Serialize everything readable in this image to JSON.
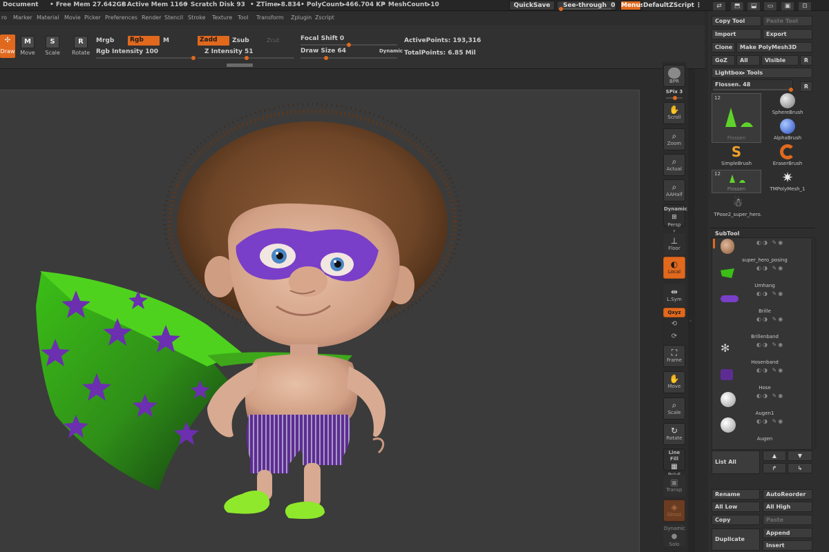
{
  "titlebar": {
    "document": "Document",
    "free_mem": "• Free Mem 27.642GB",
    "active_mem": "• Active Mem 1166",
    "scratch_disk": "• Scratch Disk 93",
    "ztime": "• ZTime▸8.834",
    "polycount": "• PolyCount▸466.704 KP",
    "meshcount": "• MeshCount▸10",
    "quicksave": "QuickSave",
    "see_through": "See-through",
    "see_through_value": "0",
    "menus": "Menus",
    "default_zscript": "DefaultZScript"
  },
  "menubar": [
    "ro",
    "Marker",
    "Material",
    "Movie",
    "Picker",
    "Preferences",
    "Render",
    "Stencil",
    "Stroke",
    "Texture",
    "Tool",
    "Transform",
    "Zplugin",
    "Zscript"
  ],
  "toolbar": {
    "draw": "Draw",
    "move": "Move",
    "scale": "Scale",
    "rotate": "Rotate",
    "mrgb": "Mrgb",
    "rgb": "Rgb",
    "m": "M",
    "rgb_intensity": "Rgb Intensity 100",
    "zadd": "Zadd",
    "zsub": "Zsub",
    "zcut": "Zcut",
    "z_intensity": "Z Intensity 51",
    "focal_shift": "Focal Shift 0",
    "draw_size": "Draw Size 64",
    "dynamic": "Dynamic",
    "active_points": "ActivePoints: 193,316",
    "total_points": "TotalPoints: 6.85 Mil"
  },
  "toolbar_levels": {
    "rgb_intensity": 100,
    "z_intensity": 51,
    "focal_shift": 0,
    "draw_size": 64
  },
  "shelf": {
    "bpr": "BPR",
    "spix": "SPix 3",
    "scroll": "Scroll",
    "zoom": "Zoom",
    "actual": "Actual",
    "aahalf": "AAHalf",
    "dynamic": "Dynamic",
    "persp": "Persp",
    "floor": "Floor",
    "local": "Local",
    "lsym": "L.Sym",
    "xyz": "Qxyz",
    "frame": "Frame",
    "move": "Move",
    "scale": "Scale",
    "rotate": "Rotate",
    "line_fill": "Line Fill",
    "polyf": "PolyF",
    "transp": "Transp",
    "ghost": "Ghost",
    "dynamic2": "Dynamic",
    "solo": "Solo"
  },
  "palette": {
    "copy_tool": "Copy Tool",
    "paste_tool": "Paste Tool",
    "import": "Import",
    "export": "Export",
    "clone": "Clone",
    "make_polymesh": "Make PolyMesh3D",
    "goz": "GoZ",
    "all": "All",
    "visible": "Visible",
    "r": "R",
    "lightbox_tools": "Lightbox▸ Tools",
    "flossen": "Flossen. 48",
    "brushes": [
      {
        "label": "Flossen",
        "count": "12"
      },
      {
        "label": "SphereBrush"
      },
      {
        "label": "AlphaBrush"
      },
      {
        "label": "SimpleBrush"
      },
      {
        "label": "EraserBrush"
      },
      {
        "label": "Flossen",
        "count": "12"
      },
      {
        "label": "TMPolyMesh_1"
      },
      {
        "label": "TPose2_super_hero."
      }
    ],
    "subtool_title": "SubTool",
    "subtools": [
      "super_hero_posing",
      "Umhang",
      "Brille",
      "Brillenband",
      "Hosenband",
      "Hose",
      "Augen1",
      "Augen"
    ],
    "list_all": "List All",
    "rename": "Rename",
    "autoreorder": "AutoReorder",
    "all_low": "All Low",
    "all_high": "All High",
    "copy": "Copy",
    "paste": "Paste",
    "duplicate": "Duplicate",
    "append": "Append",
    "insert": "Insert"
  },
  "colors": {
    "accent": "#e0691e",
    "panel": "#2e2e2e",
    "canvas": "#3b3b3b",
    "cape_green": "#3fc11c",
    "star_purple": "#6b2fb0",
    "mask_purple": "#7a3fc8",
    "hair_brown": "#6e4527",
    "skin": "#d9a98d",
    "fins_green": "#8fe82b"
  }
}
